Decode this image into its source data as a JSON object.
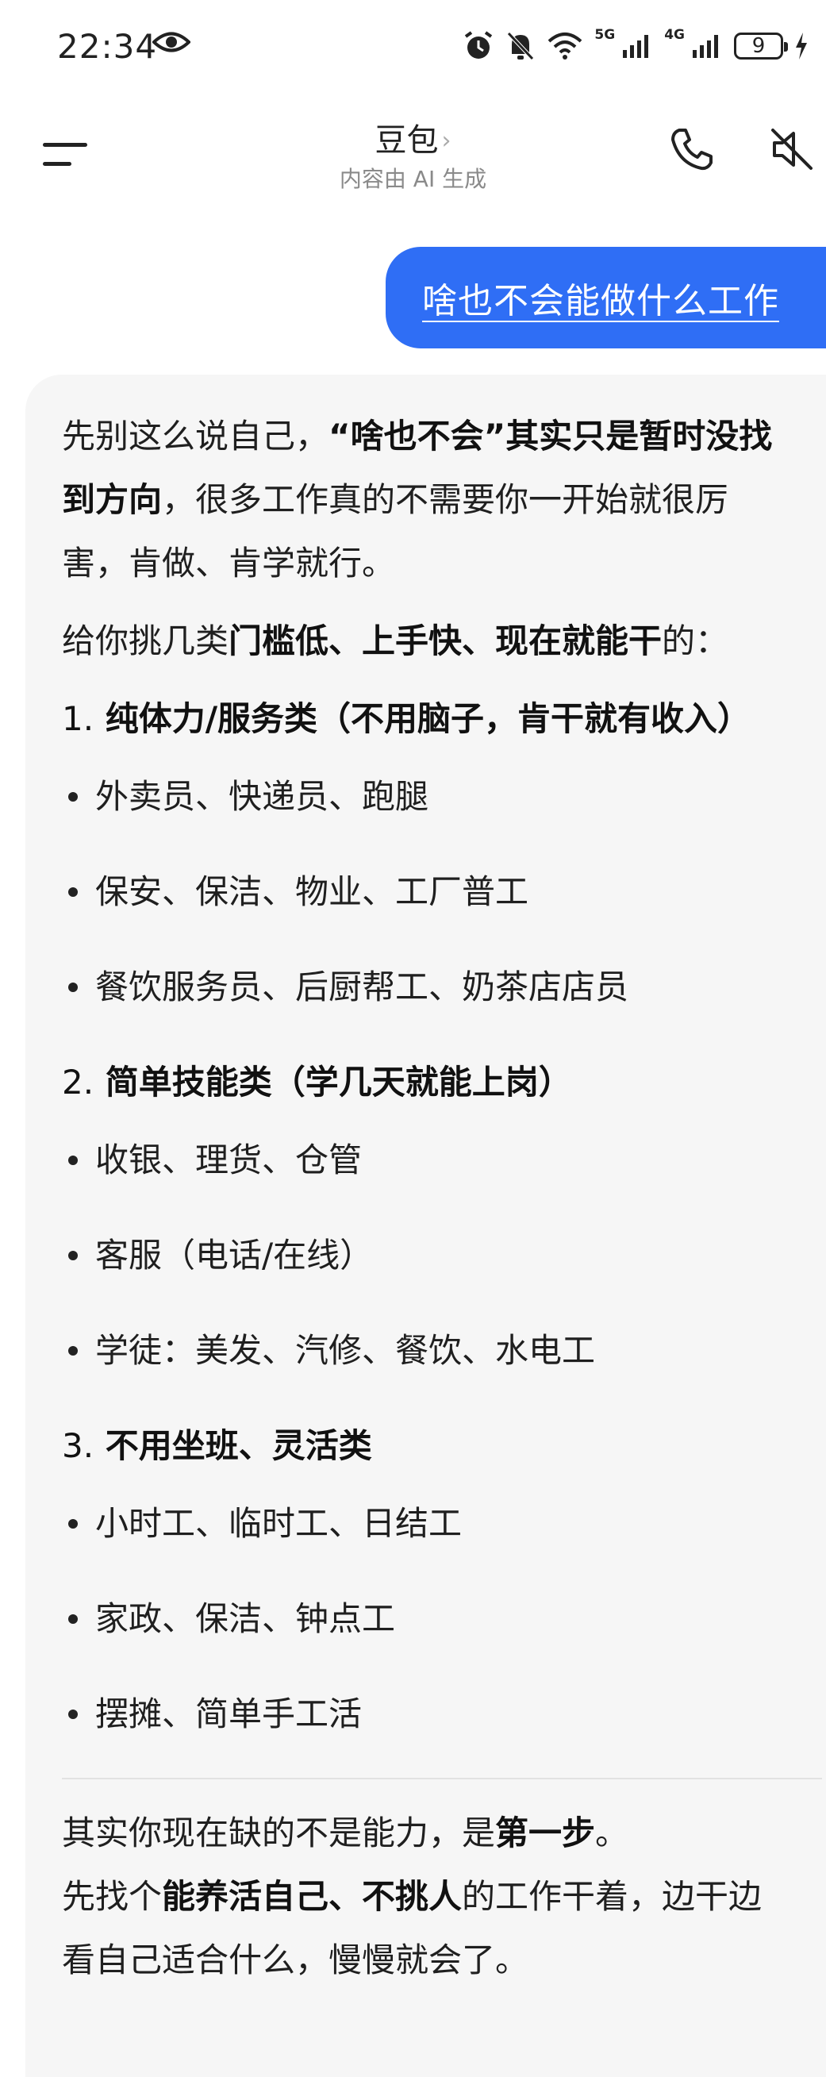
{
  "status_bar": {
    "time": "22:34",
    "battery": "9",
    "net1": "5G",
    "net2": "4G",
    "icons": [
      "eye-icon",
      "alarm-icon",
      "mute-bell-icon",
      "wifi-icon",
      "signal-5g-icon",
      "signal-4g-icon",
      "battery-icon",
      "charging-bolt-icon"
    ]
  },
  "header": {
    "title": "豆包",
    "chevron": "›",
    "subtitle": "内容由 AI 生成",
    "icons": [
      "menu-icon",
      "phone-icon",
      "speaker-mute-icon"
    ]
  },
  "user_message": "啥也不会能做什么工作",
  "ai_message": {
    "intro": {
      "p1": "先别这么说自己，",
      "b1": "“啥也不会”其实只是暂时没找到方向",
      "p2": "，很多工作真的不需要你一开始就很厉害，肯做、肯学就行。"
    },
    "lead": {
      "p1": "给你挑几类",
      "b1": "门槛低、上手快、现在就能干",
      "p2": "的："
    },
    "sections": [
      {
        "num": "1.",
        "title": "纯体力/服务类（不用脑子，肯干就有收入）",
        "items": [
          "外卖员、快递员、跑腿",
          "保安、保洁、物业、工厂普工",
          "餐饮服务员、后厨帮工、奶茶店店员"
        ]
      },
      {
        "num": "2.",
        "title": "简单技能类（学几天就能上岗）",
        "items": [
          "收银、理货、仓管",
          "客服（电话/在线）",
          "学徒：美发、汽修、餐饮、水电工"
        ]
      },
      {
        "num": "3.",
        "title": "不用坐班、灵活类",
        "items": [
          "小时工、临时工、日结工",
          "家政、保洁、钟点工",
          "摆摊、简单手工活"
        ]
      }
    ],
    "closing": {
      "p1": "其实你现在缺的不是能力，是",
      "b1": "第一步",
      "p2": "。",
      "p3": "先找个",
      "b2": "能养活自己、不挑人",
      "p4": "的工作干着，边干边看自己适合什么，慢慢就会了。"
    }
  },
  "colors": {
    "accent": "#2f6ef5",
    "card_bg": "#f6f6f6"
  }
}
